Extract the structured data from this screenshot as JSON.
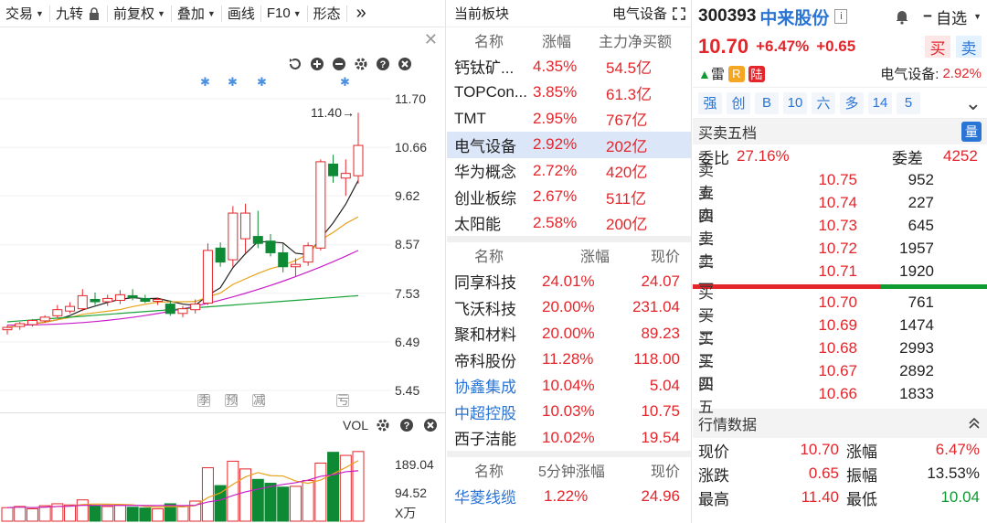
{
  "toolbar": {
    "items": [
      "交易",
      "九转",
      "前复权",
      "叠加",
      "画线",
      "F10",
      "形态"
    ]
  },
  "chart": {
    "y_ticks": [
      "11.70",
      "10.66",
      "9.62",
      "8.57",
      "7.53",
      "6.49",
      "5.45"
    ],
    "high_label": "11.40",
    "annotations": [
      "季",
      "预",
      "减",
      "亏"
    ],
    "vol_label": "VOL",
    "vol_ticks": [
      "189.04",
      "94.52"
    ],
    "vol_unit": "X万"
  },
  "chart_data": {
    "type": "candlestick",
    "y_ticks": [
      11.7,
      10.66,
      9.62,
      8.57,
      7.53,
      6.49,
      5.45
    ],
    "candles": [
      {
        "o": 6.75,
        "h": 6.85,
        "l": 6.65,
        "c": 6.8,
        "up": true
      },
      {
        "o": 6.82,
        "h": 6.92,
        "l": 6.75,
        "c": 6.88,
        "up": true
      },
      {
        "o": 6.86,
        "h": 6.98,
        "l": 6.82,
        "c": 6.95,
        "up": true
      },
      {
        "o": 6.94,
        "h": 7.06,
        "l": 6.9,
        "c": 7.02,
        "up": true
      },
      {
        "o": 7.05,
        "h": 7.28,
        "l": 7.0,
        "c": 7.18,
        "up": true
      },
      {
        "o": 7.15,
        "h": 7.34,
        "l": 7.1,
        "c": 7.25,
        "up": true
      },
      {
        "o": 7.2,
        "h": 7.62,
        "l": 7.15,
        "c": 7.48,
        "up": true
      },
      {
        "o": 7.4,
        "h": 7.55,
        "l": 7.28,
        "c": 7.35,
        "up": false
      },
      {
        "o": 7.35,
        "h": 7.5,
        "l": 7.26,
        "c": 7.42,
        "up": true
      },
      {
        "o": 7.38,
        "h": 7.6,
        "l": 7.3,
        "c": 7.5,
        "up": true
      },
      {
        "o": 7.48,
        "h": 7.62,
        "l": 7.38,
        "c": 7.44,
        "up": false
      },
      {
        "o": 7.42,
        "h": 7.5,
        "l": 7.32,
        "c": 7.36,
        "up": false
      },
      {
        "o": 7.36,
        "h": 7.44,
        "l": 7.28,
        "c": 7.4,
        "up": true
      },
      {
        "o": 7.3,
        "h": 7.38,
        "l": 7.05,
        "c": 7.1,
        "up": false
      },
      {
        "o": 7.1,
        "h": 7.26,
        "l": 7.02,
        "c": 7.2,
        "up": true
      },
      {
        "o": 7.18,
        "h": 7.4,
        "l": 7.1,
        "c": 7.3,
        "up": true
      },
      {
        "o": 7.32,
        "h": 8.6,
        "l": 7.28,
        "c": 8.45,
        "up": true
      },
      {
        "o": 8.5,
        "h": 8.62,
        "l": 8.1,
        "c": 8.2,
        "up": false
      },
      {
        "o": 8.25,
        "h": 9.4,
        "l": 8.1,
        "c": 9.25,
        "up": true
      },
      {
        "o": 9.25,
        "h": 9.45,
        "l": 8.4,
        "c": 8.7,
        "up": true
      },
      {
        "o": 8.75,
        "h": 9.3,
        "l": 8.5,
        "c": 8.6,
        "up": false
      },
      {
        "o": 8.65,
        "h": 8.8,
        "l": 8.32,
        "c": 8.4,
        "up": false
      },
      {
        "o": 8.4,
        "h": 8.6,
        "l": 7.98,
        "c": 8.1,
        "up": false
      },
      {
        "o": 8.1,
        "h": 8.28,
        "l": 7.9,
        "c": 8.15,
        "up": true
      },
      {
        "o": 8.2,
        "h": 8.62,
        "l": 8.12,
        "c": 8.55,
        "up": true
      },
      {
        "o": 8.5,
        "h": 10.4,
        "l": 8.45,
        "c": 10.35,
        "up": true
      },
      {
        "o": 10.3,
        "h": 10.5,
        "l": 9.9,
        "c": 10.05,
        "up": false
      },
      {
        "o": 10.0,
        "h": 10.4,
        "l": 9.62,
        "c": 10.1,
        "up": true
      },
      {
        "o": 10.05,
        "h": 11.4,
        "l": 9.88,
        "c": 10.7,
        "up": true
      }
    ],
    "volumes": [
      35,
      38,
      32,
      40,
      45,
      42,
      55,
      40,
      38,
      42,
      36,
      34,
      32,
      45,
      38,
      52,
      138,
      92,
      155,
      135,
      108,
      98,
      88,
      90,
      105,
      150,
      178,
      170,
      180
    ]
  },
  "mid": {
    "header_title": "当前板块",
    "header_sector": "电气设备",
    "sector_cols": [
      "名称",
      "涨幅",
      "主力净买额"
    ],
    "sectors": [
      {
        "name": "钙钛矿...",
        "pct": "4.35%",
        "amt": "54.5亿",
        "sel": false
      },
      {
        "name": "TOPCon...",
        "pct": "3.85%",
        "amt": "61.3亿",
        "sel": false
      },
      {
        "name": "TMT",
        "pct": "2.95%",
        "amt": "767亿",
        "sel": false
      },
      {
        "name": "电气设备",
        "pct": "2.92%",
        "amt": "202亿",
        "sel": true
      },
      {
        "name": "华为概念",
        "pct": "2.72%",
        "amt": "420亿",
        "sel": false
      },
      {
        "name": "创业板综",
        "pct": "2.67%",
        "amt": "511亿",
        "sel": false
      },
      {
        "name": "太阳能",
        "pct": "2.58%",
        "amt": "200亿",
        "sel": false
      }
    ],
    "stock_cols": [
      "名称",
      "涨幅",
      "现价"
    ],
    "stocks": [
      {
        "name": "同享科技",
        "pct": "24.01%",
        "price": "24.07",
        "blue": false
      },
      {
        "name": "飞沃科技",
        "pct": "20.00%",
        "price": "231.04",
        "blue": false
      },
      {
        "name": "聚和材料",
        "pct": "20.00%",
        "price": "89.23",
        "blue": false
      },
      {
        "name": "帝科股份",
        "pct": "11.28%",
        "price": "118.00",
        "blue": false
      },
      {
        "name": "协鑫集成",
        "pct": "10.04%",
        "price": "5.04",
        "blue": true
      },
      {
        "name": "中超控股",
        "pct": "10.03%",
        "price": "10.75",
        "blue": true
      },
      {
        "name": "西子洁能",
        "pct": "10.02%",
        "price": "19.54",
        "blue": false
      }
    ],
    "fivemin_cols": [
      "名称",
      "5分钟涨幅",
      "现价"
    ],
    "fivemin": [
      {
        "name": "华菱线缆",
        "pct": "1.22%",
        "price": "24.96"
      }
    ]
  },
  "right": {
    "code": "300393",
    "name": "中来股份",
    "watch_label": "自选",
    "price": "10.70",
    "pct": "+6.47%",
    "chg": "+0.65",
    "buy_label": "买",
    "sell_label": "卖",
    "tags": [
      "雷",
      "R",
      "陆"
    ],
    "sector_label": "电气设备:",
    "sector_pct": "2.92%",
    "mini_btns": [
      "强",
      "创",
      "B",
      "10",
      "六",
      "多",
      "14",
      "5"
    ],
    "orderbook_title": "买卖五档",
    "orderbook_badge": "量",
    "weibi_label": "委比",
    "weibi": "27.16%",
    "weicha_label": "委差",
    "weicha": "4252",
    "asks": [
      {
        "l": "卖五",
        "p": "10.75",
        "v": "952"
      },
      {
        "l": "卖四",
        "p": "10.74",
        "v": "227"
      },
      {
        "l": "卖三",
        "p": "10.73",
        "v": "645"
      },
      {
        "l": "卖二",
        "p": "10.72",
        "v": "1957"
      },
      {
        "l": "卖一",
        "p": "10.71",
        "v": "1920"
      }
    ],
    "bids": [
      {
        "l": "买一",
        "p": "10.70",
        "v": "761"
      },
      {
        "l": "买二",
        "p": "10.69",
        "v": "1474"
      },
      {
        "l": "买三",
        "p": "10.68",
        "v": "2993"
      },
      {
        "l": "买四",
        "p": "10.67",
        "v": "2892"
      },
      {
        "l": "买五",
        "p": "10.66",
        "v": "1833"
      }
    ],
    "quote_title": "行情数据",
    "quotes": [
      {
        "k1": "现价",
        "v1": "10.70",
        "c1": "red",
        "k2": "涨幅",
        "v2": "6.47%",
        "c2": "red"
      },
      {
        "k1": "涨跌",
        "v1": "0.65",
        "c1": "red",
        "k2": "振幅",
        "v2": "13.53%",
        "c2": "dark"
      },
      {
        "k1": "最高",
        "v1": "11.40",
        "c1": "red",
        "k2": "最低",
        "v2": "10.04",
        "c2": "green"
      }
    ]
  }
}
